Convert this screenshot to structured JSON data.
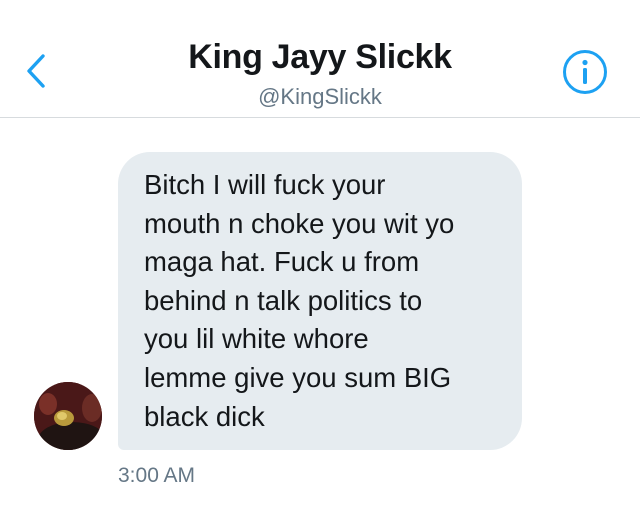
{
  "header": {
    "title": "King Jayy Slickk",
    "handle": "@KingSlickk",
    "back_icon": "chevron-left-icon",
    "info_icon": "info-circle-icon"
  },
  "message": {
    "text": "Bitch I will fuck your\nmouth n choke you wit yo\nmaga hat. Fuck u from\nbehind n talk politics to\nyou lil white whore\nlemme give you sum BIG\nblack dick",
    "time": "3:00 AM"
  },
  "colors": {
    "accent": "#1da1f2",
    "bubble": "#e6ecf0",
    "secondary_text": "#657786"
  }
}
